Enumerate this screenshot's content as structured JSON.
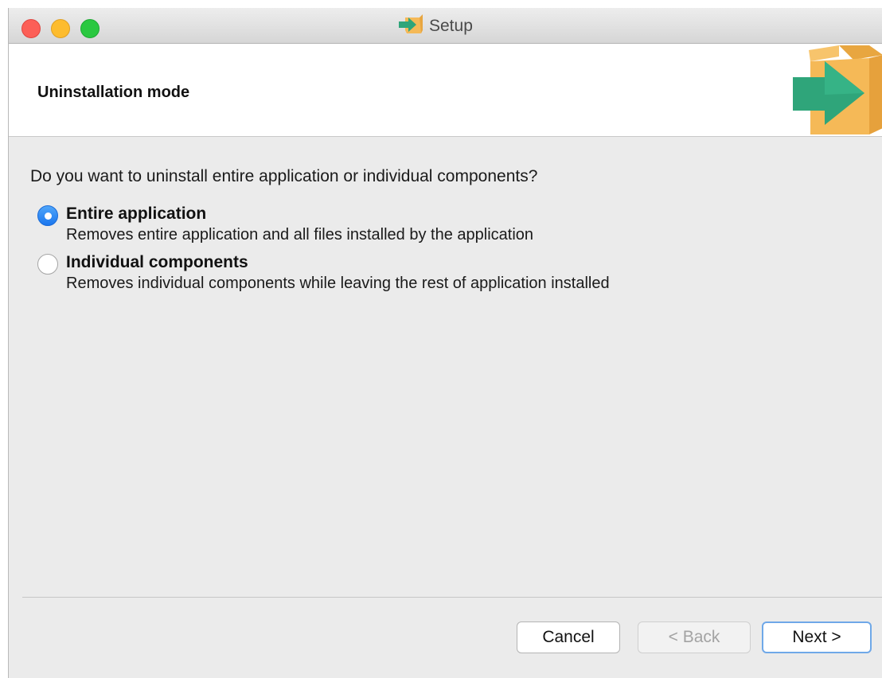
{
  "window": {
    "title": "Setup",
    "title_icon": "installer-box-arrow-icon"
  },
  "header": {
    "title": "Uninstallation mode",
    "logo_icon": "installer-box-arrow-icon"
  },
  "content": {
    "question": "Do you want to uninstall entire application or individual components?",
    "options": [
      {
        "label": "Entire application",
        "description": "Removes entire application and all files installed by the application",
        "selected": true
      },
      {
        "label": "Individual components",
        "description": "Removes individual components while leaving the rest of application installed",
        "selected": false
      }
    ]
  },
  "buttons": {
    "cancel": "Cancel",
    "back": "< Back",
    "next": "Next >"
  },
  "colors": {
    "accent": "#1b76ee",
    "box": "#f5b957",
    "arrow": "#2fa57a"
  }
}
